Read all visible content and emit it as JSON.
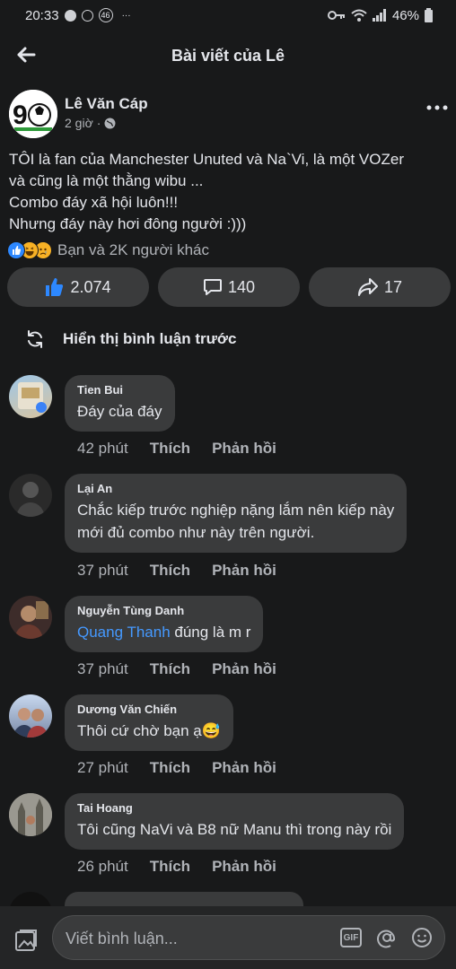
{
  "status_bar": {
    "time": "20:33",
    "notif_badge": "46",
    "dots": "···",
    "battery": "46%"
  },
  "header": {
    "title": "Bài viết của Lê"
  },
  "post": {
    "author": "Lê Văn Cáp",
    "time": "2 giờ",
    "separator": "·",
    "lines": [
      "TÔI là fan của Manchester Unuted và Na`Vi, là một VOZer",
      "và cũng là một thằng wibu ...",
      "Combo đáy xã hội luôn!!!",
      "Nhưng đáy này hơi đông người :)))"
    ],
    "reactions_text": "Bạn và 2K người khác",
    "like_count": "2.074",
    "comment_count": "140",
    "share_count": "17"
  },
  "previous_comments_label": "Hiển thị bình luận trước",
  "comments": [
    {
      "name": "Tien Bui",
      "text": "Đáy của đáy",
      "time": "42 phút",
      "like": "Thích",
      "reply": "Phản hồi"
    },
    {
      "name": "Lại An",
      "line1": "Chắc kiếp trước nghiệp nặng lắm nên kiếp này",
      "line2": "mới đủ combo như này trên người.",
      "time": "37 phút",
      "like": "Thích",
      "reply": "Phản hồi"
    },
    {
      "name": "Nguyễn Tùng Danh",
      "mention": "Quang Thanh",
      "text": " đúng là m r",
      "time": "37 phút",
      "like": "Thích",
      "reply": "Phản hồi"
    },
    {
      "name": "Dương Văn Chiến",
      "text": "Thôi cứ chờ bạn ạ😅",
      "time": "27 phút",
      "like": "Thích",
      "reply": "Phản hồi"
    },
    {
      "name": "Tai Hoang",
      "text": "Tôi cũng NaVi và B8 nữ Manu thì trong này rồi",
      "time": "26 phút",
      "like": "Thích",
      "reply": "Phản hồi"
    }
  ],
  "composer": {
    "placeholder": "Viết bình luận...",
    "gif_label": "GIF"
  },
  "colors": {
    "background": "#18191a",
    "bubble": "#3a3b3c",
    "mention": "#4599ff",
    "like_blue": "#2d88ff"
  }
}
